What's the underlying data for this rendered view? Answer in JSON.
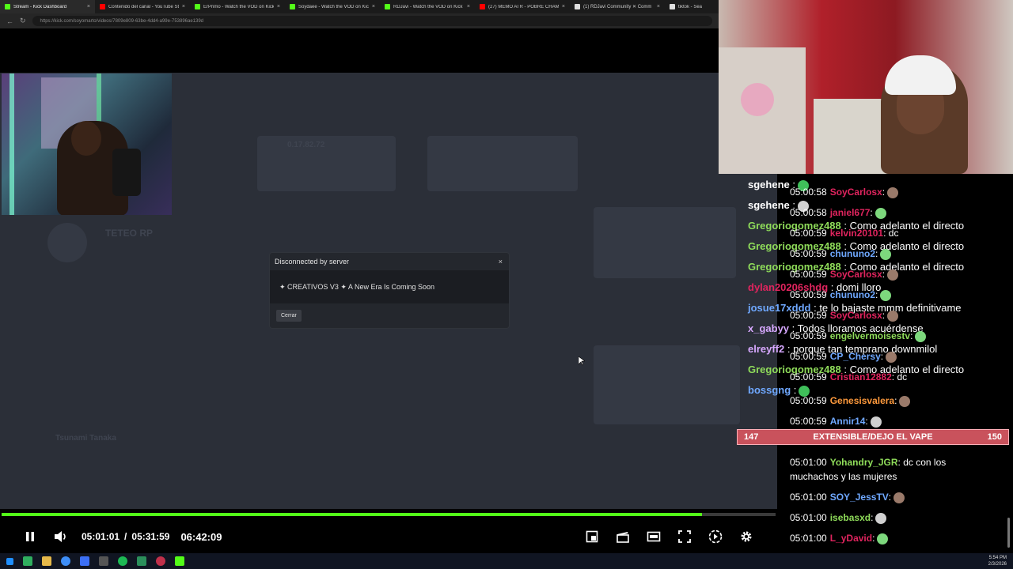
{
  "browser": {
    "tabs": [
      {
        "label": "Stream - Kick Dashboard",
        "color": "#53fc18"
      },
      {
        "label": "Contenido del canal - YouTube St",
        "color": "#ff0000"
      },
      {
        "label": "ErPrimo - Watch the VOD on Kick",
        "color": "#53fc18"
      },
      {
        "label": "Soydaee - Watch the VOD on Kick",
        "color": "#53fc18"
      },
      {
        "label": "RDJavi - Watch the VOD on Kick",
        "color": "#53fc18"
      },
      {
        "label": "(27) MEMO ATR - POBRE CHAMO",
        "color": "#ff0000"
      },
      {
        "label": "(1) RDJavi Community ✕ Comm",
        "color": "#dddddd"
      },
      {
        "label": "tiktok - Sea",
        "color": "#dddddd"
      }
    ],
    "url": "https://kick.com/soyomarto/videos/7809e809-63be-4dd4-a99e-753896ae139d"
  },
  "background": {
    "ghost_title": "TETEO RP",
    "ghost_sub": "Tsunami Tanaka",
    "ghost_ver": "0.17.82.72"
  },
  "dialog": {
    "title": "Disconnected by server",
    "close": "×",
    "message": "✦ CREATIVOS V3 ✦ A New Era Is Coming Soon",
    "button": "Cerrar"
  },
  "player": {
    "current": "05:01:01",
    "separator": "/",
    "duration": "05:31:59",
    "clock": "06:42:09",
    "progress_fraction": 0.905
  },
  "chat": {
    "lines": [
      {
        "user": "sgehene",
        "sep": " :",
        "msg": "",
        "ucolor": "#ffffff",
        "big": true
      },
      {
        "ts": "05:00:58",
        "user": "SoyCarlosx",
        "sep": ":",
        "msg": "",
        "ucolor": "#e0245e"
      },
      {
        "user": "sgehene",
        "sep": " :",
        "msg": "",
        "ucolor": "#ffffff",
        "big": true
      },
      {
        "ts": "05:00:58",
        "user": "janiel677",
        "sep": ":",
        "msg": "",
        "ucolor": "#e0245e"
      },
      {
        "user": "Gregoriogomez488",
        "sep": " :",
        "msg": " Como adelanto el directo",
        "ucolor": "#8fdc5a",
        "big": true
      },
      {
        "ts": "05:00:59",
        "user": "kelvin20101",
        "sep": ":",
        "msg": " dc",
        "ucolor": "#e0245e"
      },
      {
        "user": "Gregoriogomez488",
        "sep": " :",
        "msg": " Como adelanto el directo",
        "ucolor": "#8fdc5a",
        "big": true
      },
      {
        "ts": "05:00:59",
        "user": "chununo2",
        "sep": ":",
        "msg": "",
        "ucolor": "#6fa8ff"
      },
      {
        "user": "Gregoriogomez488",
        "sep": " :",
        "msg": " Como adelanto el directo",
        "ucolor": "#8fdc5a",
        "big": true
      },
      {
        "ts": "05:00:59",
        "user": "SoyCarlosx",
        "sep": ":",
        "msg": "",
        "ucolor": "#e0245e"
      },
      {
        "user": "dylan20206shdg",
        "sep": " :",
        "msg": " domi lloro",
        "ucolor": "#e0245e",
        "big": true
      },
      {
        "ts": "05:00:59",
        "user": "chununo2",
        "sep": ":",
        "msg": "",
        "ucolor": "#6fa8ff"
      },
      {
        "user": "josue17xddd",
        "sep": " :",
        "msg": " te lo bajaste mmm definitivame",
        "ucolor": "#6fa8ff",
        "big": true
      },
      {
        "ts": "05:00:59",
        "user": "SoyCarlosx",
        "sep": ":",
        "msg": "",
        "ucolor": "#e0245e"
      },
      {
        "user": "x_gabyy",
        "sep": " :",
        "msg": " Todos lloramos acuérdense",
        "ucolor": "#d7a8ff",
        "big": true
      },
      {
        "ts": "05:00:59",
        "user": "engelvermoisestv",
        "sep": ":",
        "msg": "",
        "ucolor": "#8fdc5a"
      },
      {
        "user": "elreyff2",
        "sep": " :",
        "msg": " porque tan temprano downmilol",
        "ucolor": "#d7a8ff",
        "big": true
      },
      {
        "ts": "05:00:59",
        "user": "CP_Chersy",
        "sep": ":",
        "msg": "",
        "ucolor": "#6fa8ff"
      },
      {
        "user": "Gregoriogomez488",
        "sep": " :",
        "msg": " Como adelanto el directo",
        "ucolor": "#8fdc5a",
        "big": true
      },
      {
        "ts": "05:00:59",
        "user": "Cristian12882",
        "sep": ":",
        "msg": " dc",
        "ucolor": "#e0245e"
      },
      {
        "user": "bossgng",
        "sep": " :",
        "msg": "",
        "ucolor": "#6fa8ff",
        "big": true
      },
      {
        "ts": "05:00:59",
        "user": "Genesisvalera",
        "sep": ":",
        "msg": "",
        "ucolor": "#ff9a3c"
      },
      {
        "ts": "05:00:59",
        "user": "Annir14",
        "sep": ":",
        "msg": "",
        "ucolor": "#6fa8ff"
      },
      {
        "ts": "05:01:00",
        "user": "Yohandry_JGR",
        "sep": ":",
        "msg": " dc con los",
        "ucolor": "#8fdc5a"
      },
      {
        "msg": "muchachos y las mujeres"
      },
      {
        "ts": "05:01:00",
        "user": "SOY_JessTV",
        "sep": ":",
        "msg": "",
        "ucolor": "#6fa8ff"
      },
      {
        "ts": "05:01:00",
        "user": "isebasxd",
        "sep": ":",
        "msg": "",
        "ucolor": "#8fdc5a"
      },
      {
        "ts": "05:01:00",
        "user": "L_yDavid",
        "sep": ":",
        "msg": "",
        "ucolor": "#e0245e"
      }
    ]
  },
  "poll": {
    "left": "147",
    "label": "EXTENSIBLE/DEJO EL VAPE",
    "right": "150"
  },
  "taskbar": {
    "time": "5:54 PM",
    "date": "2/3/2026"
  },
  "colors": {
    "accent": "#53fc18",
    "dialog_bg": "#24272d"
  }
}
